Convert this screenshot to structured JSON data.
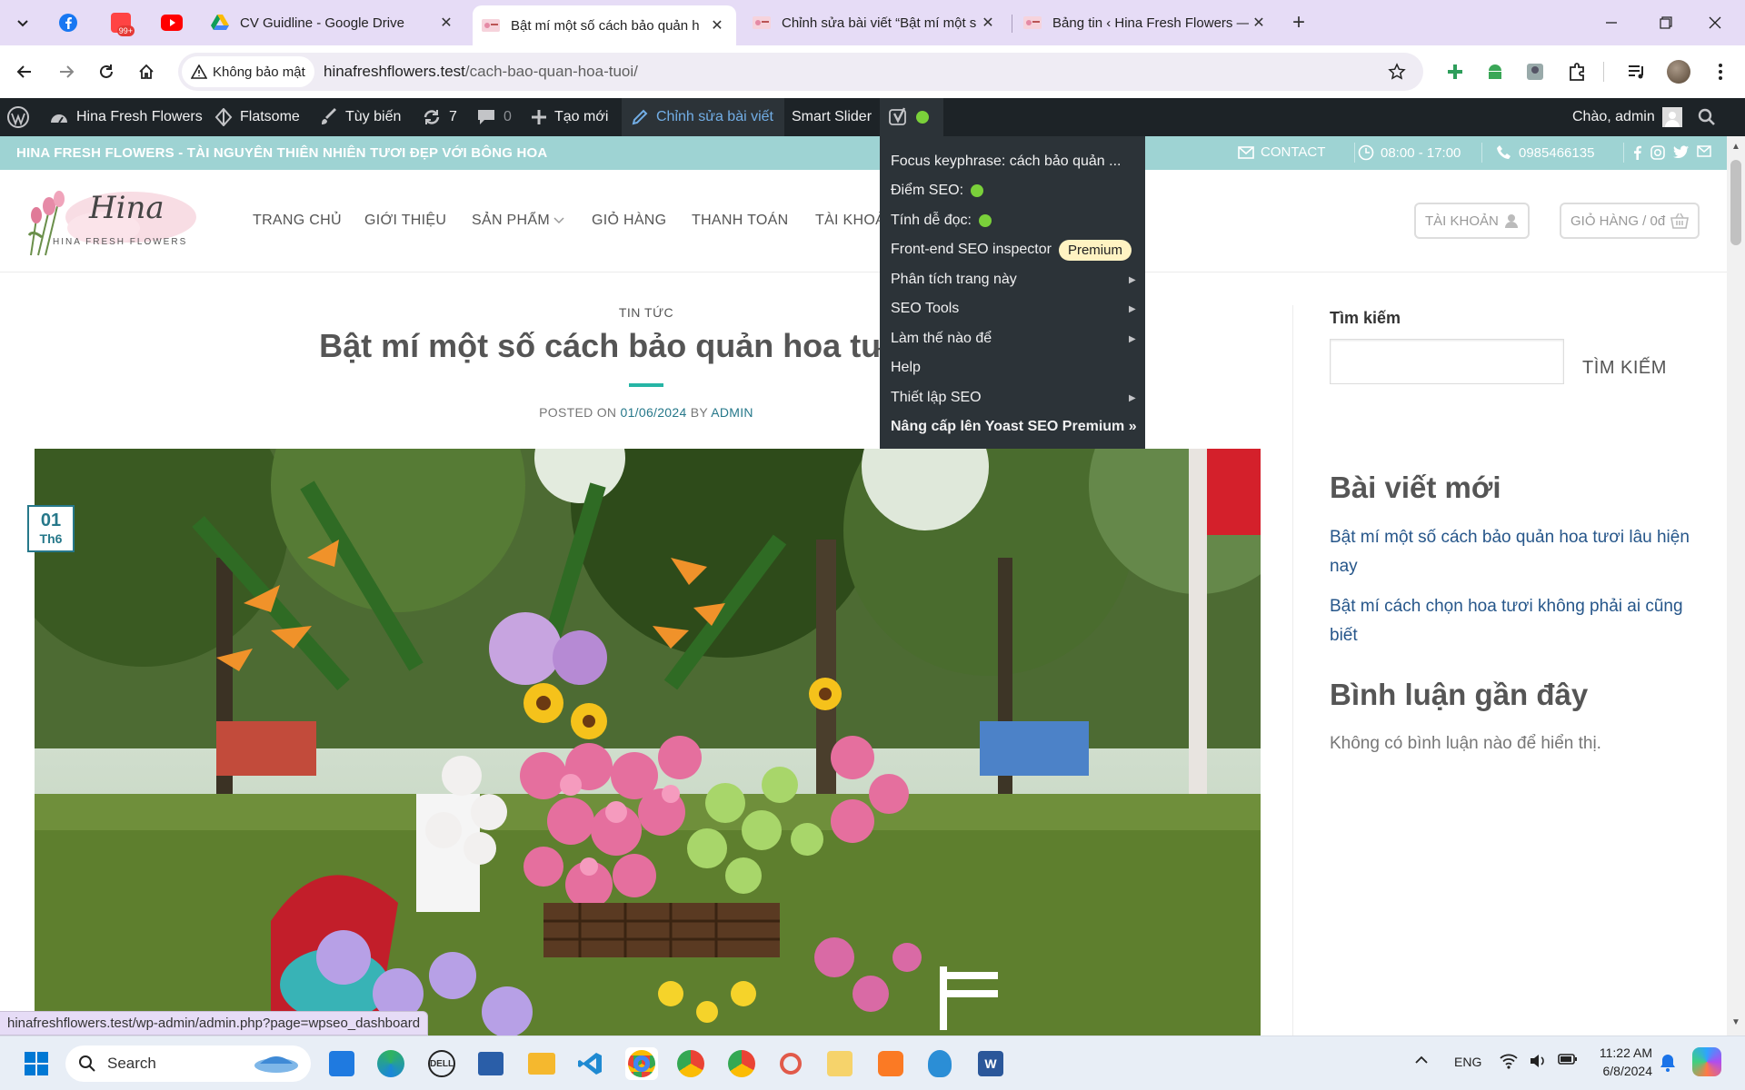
{
  "browser": {
    "tabs": [
      {
        "title": "CV Guidline - Google Drive",
        "icon": "google-drive-icon"
      },
      {
        "title": "Bật mí một số cách bảo quản h",
        "icon": "hina-favicon",
        "active": true
      },
      {
        "title": "Chỉnh sửa bài viết “Bật mí một s",
        "icon": "hina-favicon"
      },
      {
        "title": "Bảng tin ‹ Hina Fresh Flowers —",
        "icon": "hina-favicon"
      }
    ],
    "pinned_badge": "99+",
    "security_label": "Không bảo mật",
    "url_host": "hinafreshflowers.test",
    "url_path": "/cach-bao-quan-hoa-tuoi/",
    "status_url": "hinafreshflowers.test/wp-admin/admin.php?page=wpseo_dashboard"
  },
  "wp_admin_bar": {
    "site_name": "Hina Fresh Flowers",
    "theme": "Flatsome",
    "customize": "Tùy biến",
    "updates_count": "7",
    "comments_count": "0",
    "new_label": "Tạo mới",
    "edit_post": "Chỉnh sửa bài viết",
    "smart_slider": "Smart Slider",
    "greeting": "Chào, admin"
  },
  "yoast_menu": {
    "focus": "Focus keyphrase: cách bảo quản ...",
    "seo_score": "Điểm SEO:",
    "readability": "Tính dễ đọc:",
    "inspector": "Front-end SEO inspector",
    "premium_badge": "Premium",
    "analyze": "Phân tích trang này",
    "seo_tools": "SEO Tools",
    "how_to": "Làm thế nào để",
    "help": "Help",
    "settings": "Thiết lập SEO",
    "upgrade": "Nâng cấp lên Yoast SEO Premium »",
    "score_color": "#7ad03a"
  },
  "site_top_bar": {
    "tagline": "HINA FRESH FLOWERS - TÀI NGUYÊN THIÊN NHIÊN TƯƠI ĐẸP VỚI BÔNG HOA",
    "contact": "CONTACT",
    "hours": "08:00 - 17:00",
    "phone": "0985466135",
    "bar_color": "#9ed3d3"
  },
  "site_header": {
    "logo_script": "Hina",
    "logo_sub": "HINA FRESH FLOWERS",
    "nav": [
      "TRANG CHỦ",
      "GIỚI THIỆU",
      "SẢN PHẨM",
      "GIỎ HÀNG",
      "THANH TOÁN",
      "TÀI KHOẢ"
    ],
    "account_btn": "TÀI KHOẢN",
    "cart_btn": "GIỎ HÀNG / 0đ"
  },
  "post": {
    "category": "TIN TỨC",
    "title": "Bật mí một số cách bảo quản hoa tươi lâu",
    "posted_on": "POSTED ON",
    "date": "01/06/2024",
    "by": "BY",
    "author": "ADMIN",
    "badge_day": "01",
    "badge_month": "Th6",
    "accent": "#26b5a5"
  },
  "sidebar": {
    "search_label": "Tìm kiếm",
    "search_placeholder": "",
    "search_btn": "TÌM KIẾM",
    "recent_title": "Bài viết mới",
    "recent_posts": [
      "Bật mí một số cách bảo quản hoa tươi lâu hiện nay",
      "Bật mí cách chọn hoa tươi không phải ai cũng biết"
    ],
    "comments_title": "Bình luận gần đây",
    "no_comments": "Không có bình luận nào để hiển thị."
  },
  "taskbar": {
    "search": "Search",
    "lang": "ENG",
    "time": "11:22 AM",
    "date": "6/8/2024"
  }
}
